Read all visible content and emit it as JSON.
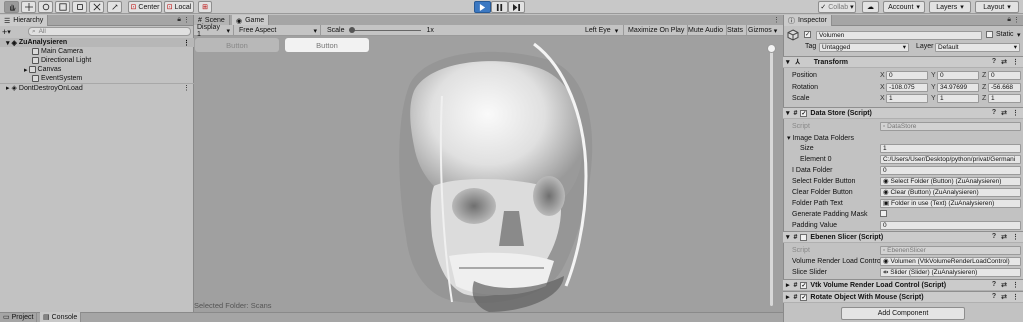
{
  "toolbar": {
    "pivot_label": "Center",
    "space_label": "Local",
    "collab_label": "Collab",
    "account_label": "Account",
    "layers_label": "Layers",
    "layout_label": "Layout"
  },
  "hierarchy": {
    "tab_label": "Hierarchy",
    "add_label": "+",
    "search_placeholder": "All",
    "items": [
      {
        "label": "ZuAnalysieren"
      },
      {
        "label": "Main Camera"
      },
      {
        "label": "Directional Light"
      },
      {
        "label": "Canvas"
      },
      {
        "label": "EventSystem"
      },
      {
        "label": "DontDestroyOnLoad"
      }
    ]
  },
  "game": {
    "scene_tab": "Scene",
    "game_tab": "Game",
    "display": "Display 1",
    "aspect": "Free Aspect",
    "scale_label": "Scale",
    "scale_value": "1x",
    "left_eye": "Left Eye",
    "maximize": "Maximize On Play",
    "mute": "Mute Audio",
    "stats": "Stats",
    "gizmos": "Gizmos",
    "button1": "Button",
    "button2": "Button",
    "selected_folder": "Selected Folder: Scans"
  },
  "inspector": {
    "tab_label": "Inspector",
    "object_name": "Volumen",
    "static_label": "Static",
    "tag_label": "Tag",
    "tag_value": "Untagged",
    "layer_label": "Layer",
    "layer_value": "Default",
    "transform": {
      "title": "Transform",
      "position_label": "Position",
      "rotation_label": "Rotation",
      "scale_label": "Scale",
      "position": {
        "x": "0",
        "y": "0",
        "z": "0"
      },
      "rotation": {
        "x": "-108.075",
        "y": "34.97699",
        "z": "-56.668"
      },
      "scale": {
        "x": "1",
        "y": "1",
        "z": "1"
      },
      "axis_x": "X",
      "axis_y": "Y",
      "axis_z": "Z"
    },
    "datastore": {
      "title": "Data Store (Script)",
      "script_label": "Script",
      "script_value": "DataStore",
      "image_folders_label": "Image Data Folders",
      "size_label": "Size",
      "size_value": "1",
      "element0_label": "Element 0",
      "element0_value": "C:/Users/User/Desktop/python/privat/Germani",
      "idata_label": "I Data Folder",
      "idata_value": "0",
      "select_btn_label": "Select Folder Button",
      "select_btn_value": "Select Folder (Button) (ZuAnalysieren)",
      "clear_btn_label": "Clear Folder Button",
      "clear_btn_value": "Clear (Button) (ZuAnalysieren)",
      "path_text_label": "Folder Path Text",
      "path_text_value": "Folder in use (Text) (ZuAnalysieren)",
      "padding_mask_label": "Generate Padding Mask",
      "padding_value_label": "Padding Value",
      "padding_value": "0"
    },
    "slicer": {
      "title": "Ebenen Slicer (Script)",
      "script_label": "Script",
      "script_value": "EbenenSlicer",
      "vrlc_label": "Volume Render Load Control",
      "vrlc_value": "Volumen (VtkVolumeRenderLoadControl)",
      "slider_label": "Slice Slider",
      "slider_value": "Slider (Slider) (ZuAnalysieren)"
    },
    "vtk_title": "Vtk Volume Render Load Control (Script)",
    "rotate_title": "Rotate Object With Mouse (Script)",
    "add_component": "Add Component"
  },
  "bottom": {
    "project_tab": "Project",
    "console_tab": "Console"
  }
}
